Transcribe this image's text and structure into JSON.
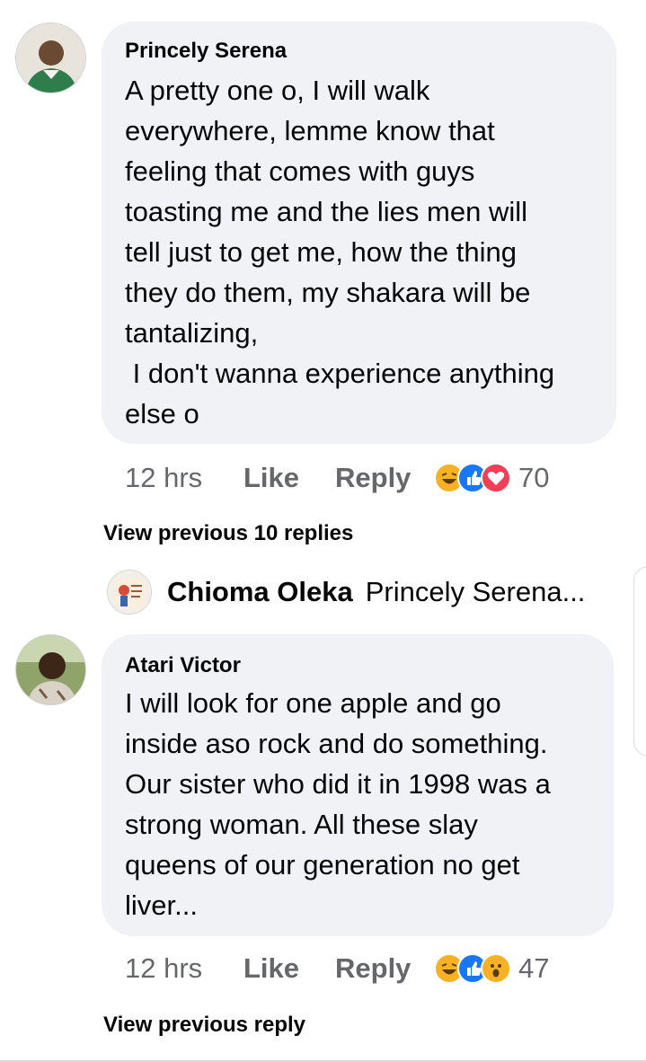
{
  "comments": [
    {
      "author": "Princely Serena",
      "text": "A pretty one o, I will walk\neverywhere, lemme know that\nfeeling that comes with guys\ntoasting me and the lies men will\ntell just to get me, how the thing\nthey do them, my shakara will be\ntantalizing,\n I don't wanna experience anything\nelse o",
      "time": "12 hrs",
      "like_label": "Like",
      "reply_label": "Reply",
      "reactions": [
        "haha",
        "like",
        "love"
      ],
      "reaction_count": "70",
      "view_more": "View previous 10 replies"
    },
    {
      "author": "Atari Victor",
      "text": "I will look for one apple and go\ninside aso rock and do something.\nOur sister who did it in 1998 was a\nstrong woman. All these slay\nqueens of our generation no get\nliver...",
      "time": "12 hrs",
      "like_label": "Like",
      "reply_label": "Reply",
      "reactions": [
        "haha",
        "like",
        "wow"
      ],
      "reaction_count": "47",
      "view_more": "View previous reply"
    }
  ],
  "collapsed_reply": {
    "author": "Chioma Oleka",
    "snippet": "Princely Serena..."
  },
  "colors": {
    "bubble": "#f0f2f5",
    "meta_text": "#65676b",
    "like_blue": "#1877f2",
    "love_red": "#f33e58",
    "reaction_yellow": "#f7b125"
  }
}
